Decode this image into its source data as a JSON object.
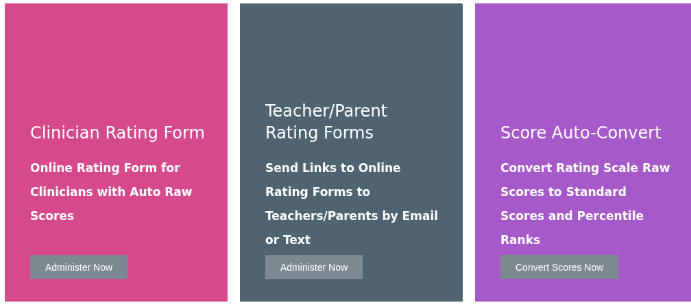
{
  "cards": [
    {
      "title": "Clinician Rating Form",
      "description": "Online Rating Form for Clinicians with Auto Raw Scores",
      "button": "Administer Now",
      "color": "#d64a8c"
    },
    {
      "title": "Teacher/Parent Rating Forms",
      "description": "Send Links to Online Rating Forms to Teachers/Parents by Email or Text",
      "button": "Administer Now",
      "color": "#4f6470"
    },
    {
      "title": "Score Auto-Convert",
      "description": "Convert Rating Scale Raw Scores to Standard Scores and Percentile Ranks",
      "button": "Convert Scores Now",
      "color": "#a659c9"
    }
  ]
}
